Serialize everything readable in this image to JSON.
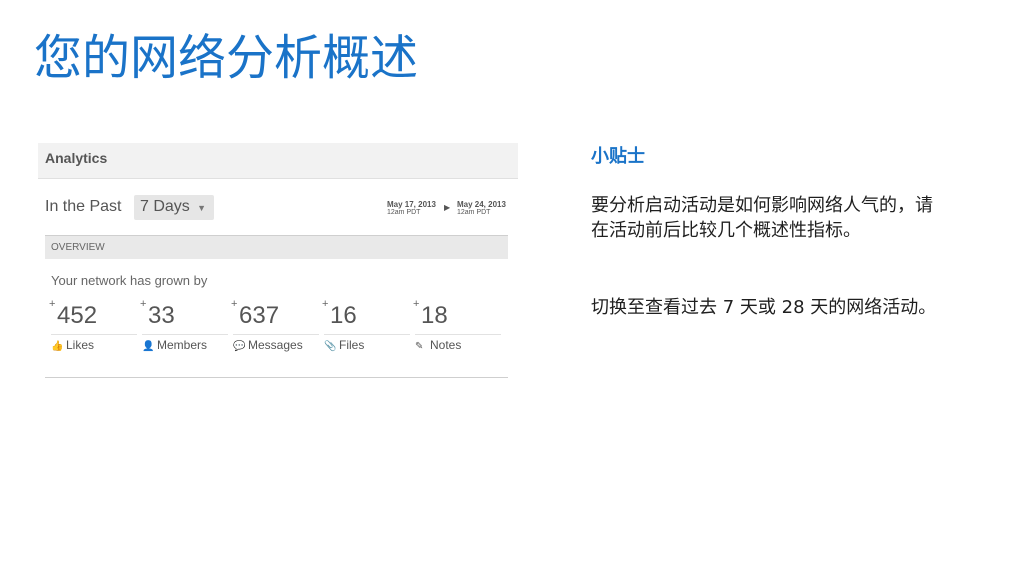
{
  "slide": {
    "title": "您的网络分析概述"
  },
  "panel": {
    "header": "Analytics",
    "range_label": "In the Past",
    "range_value": "7 Days",
    "date_from": "May 17, 2013",
    "date_from_sub": "12am PDT",
    "date_to": "May 24, 2013",
    "date_to_sub": "12am PDT",
    "overview_label": "OVERVIEW",
    "growth_text": "Your network has grown by",
    "stats": [
      {
        "plus": "+",
        "value": "452",
        "label": "Likes",
        "icon": "thumbs-up-icon"
      },
      {
        "plus": "+",
        "value": "33",
        "label": "Members",
        "icon": "person-icon"
      },
      {
        "plus": "+",
        "value": "637",
        "label": "Messages",
        "icon": "speech-bubble-icon"
      },
      {
        "plus": "+",
        "value": "16",
        "label": "Files",
        "icon": "paperclip-icon"
      },
      {
        "plus": "+",
        "value": "18",
        "label": "Notes",
        "icon": "pencil-icon"
      }
    ]
  },
  "tip": {
    "title": "小贴士",
    "paragraph1": "要分析启动活动是如何影响网络人气的，请在活动前后比较几个概述性指标。",
    "paragraph2": "切换至查看过去 7 天或 28 天的网络活动。"
  },
  "colors": {
    "accent": "#1a73c8",
    "text": "#1f1f1f"
  }
}
